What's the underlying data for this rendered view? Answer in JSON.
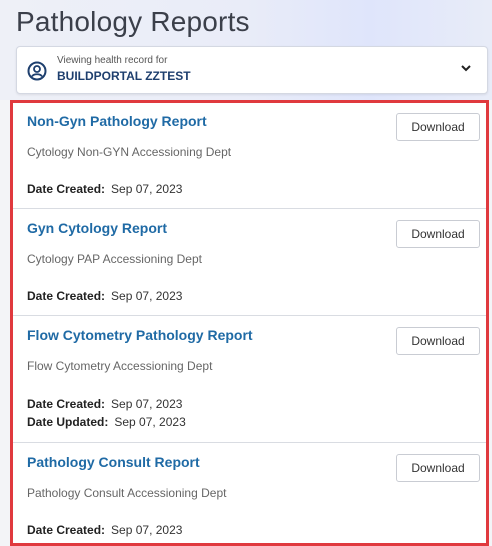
{
  "page": {
    "title": "Pathology Reports"
  },
  "patient": {
    "viewing_label": "Viewing health record for",
    "name": "BUILDPORTAL ZZTEST"
  },
  "reports": [
    {
      "title": "Non-Gyn Pathology Report",
      "dept": "Cytology Non-GYN Accessioning Dept",
      "created_label": "Date Created:",
      "created": "Sep 07, 2023",
      "download": "Download"
    },
    {
      "title": "Gyn Cytology Report",
      "dept": "Cytology PAP Accessioning Dept",
      "created_label": "Date Created:",
      "created": "Sep 07, 2023",
      "download": "Download"
    },
    {
      "title": "Flow Cytometry Pathology Report",
      "dept": "Flow Cytometry Accessioning Dept",
      "created_label": "Date Created:",
      "created": "Sep 07, 2023",
      "updated_label": "Date Updated:",
      "updated": "Sep 07, 2023",
      "download": "Download"
    },
    {
      "title": "Pathology Consult Report",
      "dept": "Pathology Consult Accessioning Dept",
      "created_label": "Date Created:",
      "created": "Sep 07, 2023",
      "download": "Download"
    }
  ],
  "colors": {
    "link": "#1f6aa5",
    "highlight": "#e0393e",
    "patient_name": "#1e3f6e"
  },
  "icons": {
    "patient": "person-circle-icon",
    "selector": "chevron-down-icon"
  }
}
